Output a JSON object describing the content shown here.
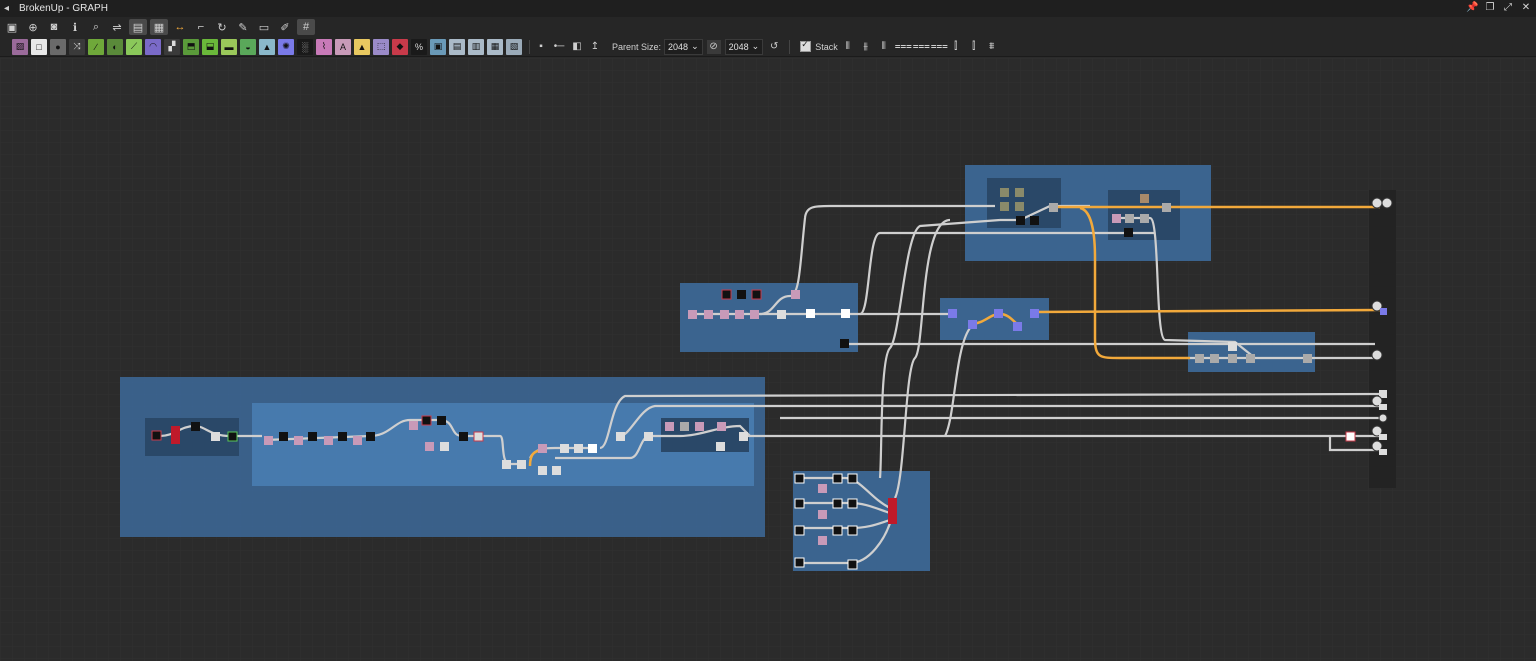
{
  "window": {
    "title": "BrokenUp - GRAPH"
  },
  "toolbar2": {
    "parent_size_label": "Parent Size:",
    "parent_size_value": "2048",
    "size_value_2": "2048",
    "stack_label": "Stack",
    "stack_checked": true
  },
  "colors": {
    "canvas_bg": "#2b2b2b",
    "frame": "#3d6a9a",
    "frame_inner": "#2a4868",
    "wire": "#cfcfcf",
    "wire_orange": "#f2a93b",
    "output_panel": "#232323"
  },
  "icons": {
    "toolbar1": [
      "frame-icon",
      "center-icon",
      "camera-icon",
      "info-icon",
      "search-icon",
      "links-icon",
      "layout-icon",
      "grid-icon",
      "arrows-icon",
      "elbow-icon",
      "refresh-icon",
      "wrench-icon",
      "display-icon",
      "brush-icon",
      "snap-grid-icon"
    ],
    "toolbar2_nodes": [
      "bitmap-icon",
      "uniform-icon",
      "drop-icon",
      "shuffle-icon",
      "curve-icon",
      "gradient-icon",
      "levels-icon",
      "blend-icon",
      "warp-icon",
      "tile-icon",
      "transform-icon",
      "switch-icon",
      "histogram-icon",
      "filter-icon",
      "color-icon",
      "normal-icon",
      "noise-icon",
      "vector-icon",
      "text-icon",
      "pixel-icon",
      "fill-icon",
      "fx-icon",
      "frame-node-icon",
      "input-icon",
      "output-icon"
    ]
  }
}
